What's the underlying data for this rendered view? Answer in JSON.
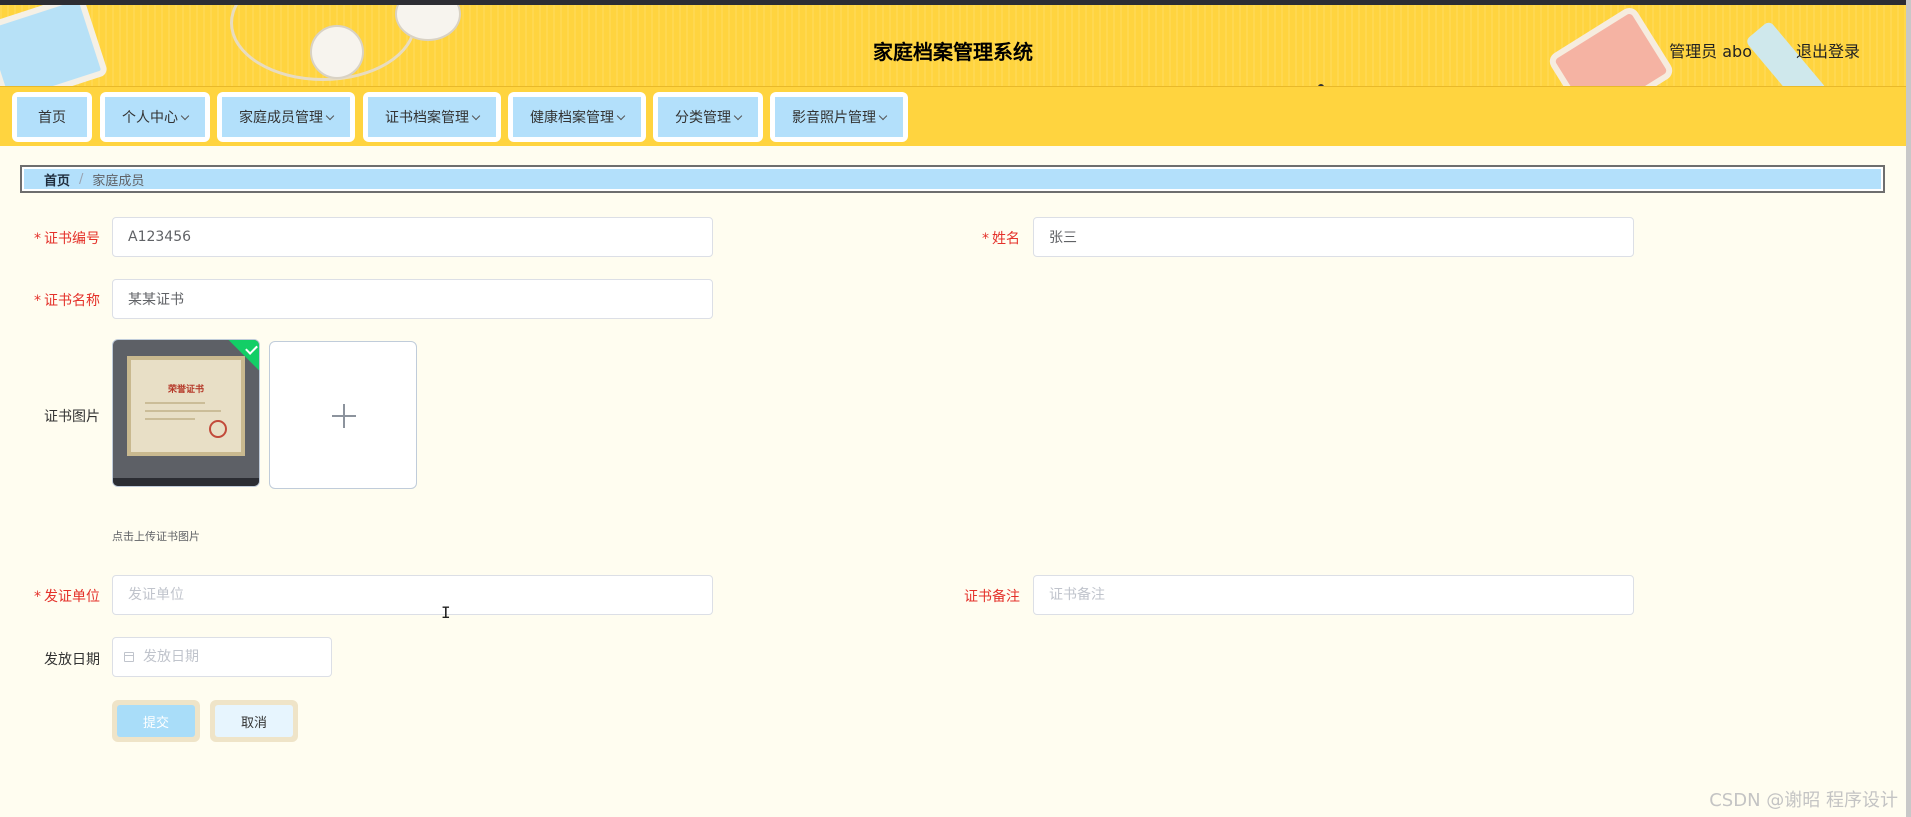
{
  "header": {
    "title": "家庭档案管理系统",
    "user": "管理员 abo",
    "logout": "退出登录"
  },
  "nav": {
    "items": [
      {
        "label": "首页",
        "dropdown": false
      },
      {
        "label": "个人中心",
        "dropdown": true
      },
      {
        "label": "家庭成员管理",
        "dropdown": true
      },
      {
        "label": "证书档案管理",
        "dropdown": true
      },
      {
        "label": "健康档案管理",
        "dropdown": true
      },
      {
        "label": "分类管理",
        "dropdown": true
      },
      {
        "label": "影音照片管理",
        "dropdown": true
      }
    ]
  },
  "breadcrumb": {
    "home": "首页",
    "separator": "/",
    "current": "家庭成员"
  },
  "form": {
    "cert_no": {
      "label": "证书编号",
      "required": true,
      "value": "A123456"
    },
    "name": {
      "label": "姓名",
      "required": true,
      "value": "张三"
    },
    "cert_name": {
      "label": "证书名称",
      "required": true,
      "value": "某某证书"
    },
    "cert_image": {
      "label": "证书图片",
      "uploaded_title": "荣誉证书",
      "hint": "点击上传证书图片"
    },
    "issuer": {
      "label": "发证单位",
      "required": true,
      "value": "",
      "placeholder": "发证单位"
    },
    "remark": {
      "label": "证书备注",
      "required": false,
      "value": "",
      "placeholder": "证书备注"
    },
    "issue_date": {
      "label": "发放日期",
      "required": false,
      "value": "",
      "placeholder": "发放日期"
    },
    "submit": "提交",
    "cancel": "取消"
  },
  "watermark": "CSDN @谢昭 程序设计",
  "colors": {
    "header_bg": "#ffd43f",
    "nav_button_bg": "#b3e0fb",
    "page_bg": "#fffdf0",
    "required_red": "#e4312a",
    "success_green": "#13ce66"
  },
  "icons": [
    "chevron-down-icon",
    "plus-icon",
    "check-icon",
    "calendar-icon"
  ]
}
